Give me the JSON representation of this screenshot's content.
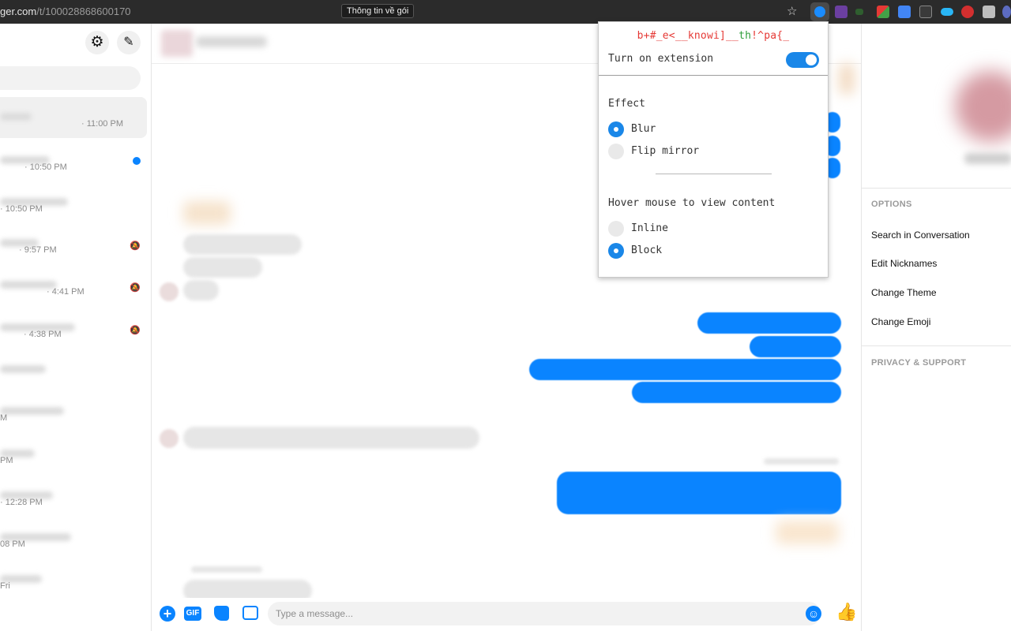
{
  "browser": {
    "url_prefix": "ger.com",
    "url_path": "/t/100028868600170",
    "tooltip": "Thông tin về gói"
  },
  "sidebar": {
    "conversations": [
      {
        "time": "· 11:00 PM",
        "active": true
      },
      {
        "time": "· 10:50 PM",
        "unread": true
      },
      {
        "time": "· 10:50 PM"
      },
      {
        "time": "· 9:57 PM",
        "muted": true
      },
      {
        "time": "· 4:41 PM",
        "muted": true
      },
      {
        "time": "· 4:38 PM",
        "muted": true
      },
      {
        "time": ""
      },
      {
        "time": "M"
      },
      {
        "time": "PM"
      },
      {
        "time": "· 12:28 PM"
      },
      {
        "time": "08 PM"
      },
      {
        "time": "Fri"
      }
    ]
  },
  "composer": {
    "gif_label": "GIF",
    "placeholder": "Type a message..."
  },
  "details": {
    "options_title": "OPTIONS",
    "options": [
      "Search in Conversation",
      "Edit Nicknames",
      "Change Theme",
      "Change Emoji"
    ],
    "privacy_title": "PRIVACY & SUPPORT"
  },
  "popup": {
    "logo_red_1": "b+#_e<__knowi]__",
    "logo_green": "th",
    "logo_red_2": "!^pa{_",
    "toggle_label": "Turn on extension",
    "toggle_on": true,
    "effect_title": "Effect",
    "effect_options": [
      {
        "label": "Blur",
        "selected": true
      },
      {
        "label": "Flip mirror",
        "selected": false
      }
    ],
    "hover_title": "Hover mouse to view content",
    "hover_options": [
      {
        "label": "Inline",
        "selected": false
      },
      {
        "label": "Block",
        "selected": true
      }
    ],
    "accent_color": "#1a87e8"
  },
  "colors": {
    "messenger_blue": "#0a84ff"
  }
}
